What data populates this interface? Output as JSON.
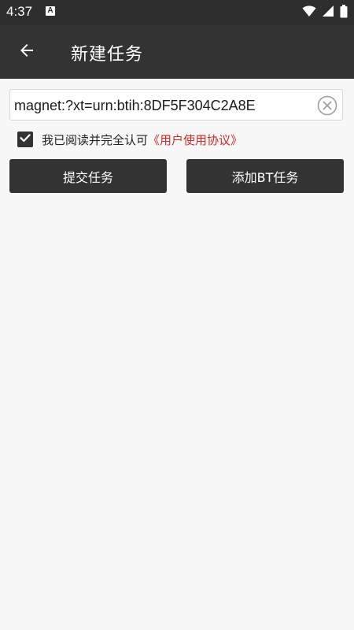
{
  "status_bar": {
    "time": "4:37",
    "notification_icon": "a-letter-icon",
    "icons": [
      "wifi-icon",
      "signal-icon",
      "battery-icon"
    ]
  },
  "app_bar": {
    "back_icon": "arrow-left-icon",
    "title": "新建任务"
  },
  "url_field": {
    "value": "magnet:?xt=urn:btih:8DF5F304C2A8E",
    "clear_icon": "clear-circle-icon"
  },
  "agreement": {
    "checked": true,
    "text": "我已阅读并完全认可",
    "link": "《用户使用协议》"
  },
  "buttons": {
    "submit": "提交任务",
    "add_bt": "添加BT任务"
  },
  "colors": {
    "app_bar": "#333333",
    "status_bar": "#2e2e2e",
    "background": "#f7f7f7",
    "link": "#cc2a2a",
    "button": "#333333"
  }
}
